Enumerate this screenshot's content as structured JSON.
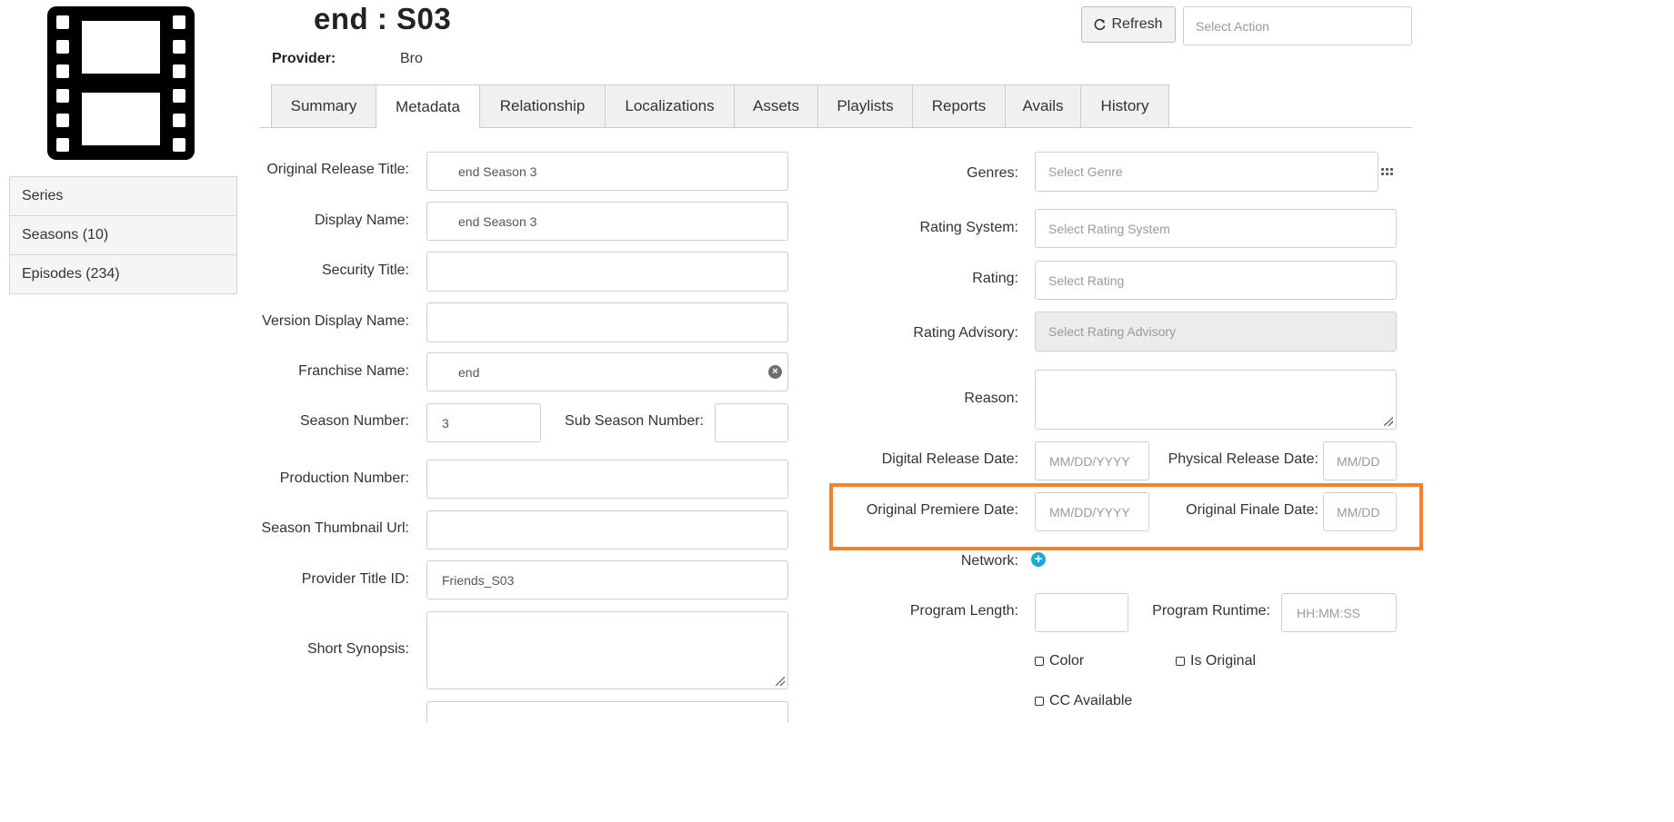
{
  "header": {
    "title": "end  : S03",
    "provider_label": "Provider:",
    "provider_value": "Bro",
    "refresh_label": "Refresh",
    "select_action_placeholder": "Select Action"
  },
  "tabs": [
    {
      "label": "Summary"
    },
    {
      "label": "Metadata",
      "active": true
    },
    {
      "label": "Relationship"
    },
    {
      "label": "Localizations"
    },
    {
      "label": "Assets"
    },
    {
      "label": "Playlists"
    },
    {
      "label": "Reports"
    },
    {
      "label": "Avails"
    },
    {
      "label": "History"
    }
  ],
  "sidebar": {
    "items": [
      {
        "label": "Series"
      },
      {
        "label": "Seasons (10)"
      },
      {
        "label": "Episodes (234)"
      }
    ]
  },
  "left_form": {
    "original_release_title": {
      "label": "Original Release Title:",
      "value": "end   Season 3"
    },
    "display_name": {
      "label": "Display Name:",
      "value": "end   Season 3"
    },
    "security_title": {
      "label": "Security Title:",
      "value": ""
    },
    "version_display_name": {
      "label": "Version Display Name:",
      "value": ""
    },
    "franchise_name": {
      "label": "Franchise Name:",
      "value": "end"
    },
    "season_number": {
      "label": "Season Number:",
      "value": "3"
    },
    "sub_season_number": {
      "label": "Sub Season Number:",
      "value": ""
    },
    "production_number": {
      "label": "Production Number:",
      "value": ""
    },
    "season_thumbnail_url": {
      "label": "Season Thumbnail Url:",
      "value": ""
    },
    "provider_title_id": {
      "label": "Provider Title ID:",
      "value": "Friends_S03"
    },
    "short_synopsis": {
      "label": "Short Synopsis:",
      "value": ""
    }
  },
  "right_form": {
    "genres": {
      "label": "Genres:",
      "placeholder": "Select Genre"
    },
    "rating_system": {
      "label": "Rating System:",
      "placeholder": "Select Rating System"
    },
    "rating": {
      "label": "Rating:",
      "placeholder": "Select Rating"
    },
    "rating_advisory": {
      "label": "Rating Advisory:",
      "placeholder": "Select Rating Advisory"
    },
    "reason": {
      "label": "Reason:",
      "value": ""
    },
    "digital_release_date": {
      "label": "Digital Release Date:",
      "placeholder": "MM/DD/YYYY"
    },
    "physical_release_date": {
      "label": "Physical Release Date:",
      "placeholder": "MM/DD"
    },
    "original_premiere_date": {
      "label": "Original Premiere Date:",
      "placeholder": "MM/DD/YYYY"
    },
    "original_finale_date": {
      "label": "Original Finale Date:",
      "placeholder": "MM/DD"
    },
    "network": {
      "label": "Network:"
    },
    "program_length": {
      "label": "Program Length:",
      "value": ""
    },
    "program_runtime": {
      "label": "Program Runtime:",
      "placeholder": "HH:MM:SS"
    },
    "checkboxes": {
      "color": "Color",
      "is_original": "Is Original",
      "cc_available": "CC Available"
    }
  },
  "colors": {
    "highlight": "#f0822d",
    "add_icon": "#1aa9d6"
  }
}
